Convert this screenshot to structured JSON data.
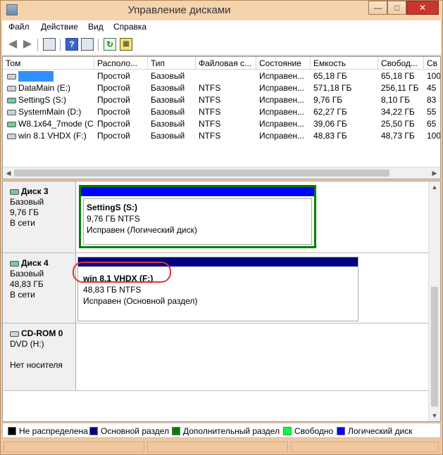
{
  "window": {
    "title": "Управление дисками"
  },
  "menu": [
    {
      "label": "Файл"
    },
    {
      "label": "Действие"
    },
    {
      "label": "Вид"
    },
    {
      "label": "Справка"
    }
  ],
  "toolbar": {
    "icons": [
      "back-icon",
      "forward-icon",
      "console-tree-icon",
      "help-icon",
      "show-action-pane-icon",
      "refresh-icon",
      "properties-icon"
    ]
  },
  "volumes": {
    "columns": [
      "Том",
      "Располо...",
      "Тип",
      "Файловая с...",
      "Состояние",
      "Емкость",
      "Свобод...",
      "Св"
    ],
    "rows": [
      {
        "name": "",
        "layout": "Простой",
        "type": "Базовый",
        "fs": "",
        "status": "Исправен...",
        "capacity": "65,18 ГБ",
        "free": "65,18 ГБ",
        "pct": "100"
      },
      {
        "name": "DataMain (E:)",
        "layout": "Простой",
        "type": "Базовый",
        "fs": "NTFS",
        "status": "Исправен...",
        "capacity": "571,18 ГБ",
        "free": "256,11 ГБ",
        "pct": "45"
      },
      {
        "name": "SettingS (S:)",
        "layout": "Простой",
        "type": "Базовый",
        "fs": "NTFS",
        "status": "Исправен...",
        "capacity": "9,76 ГБ",
        "free": "8,10 ГБ",
        "pct": "83"
      },
      {
        "name": "SystemMain (D:)",
        "layout": "Простой",
        "type": "Базовый",
        "fs": "NTFS",
        "status": "Исправен...",
        "capacity": "62,27 ГБ",
        "free": "34,22 ГБ",
        "pct": "55"
      },
      {
        "name": "W8.1x64_7mode (C:)",
        "layout": "Простой",
        "type": "Базовый",
        "fs": "NTFS",
        "status": "Исправен...",
        "capacity": "39,06 ГБ",
        "free": "25,50 ГБ",
        "pct": "65"
      },
      {
        "name": "win 8.1 VHDX (F:)",
        "layout": "Простой",
        "type": "Базовый",
        "fs": "NTFS",
        "status": "Исправен...",
        "capacity": "48,83 ГБ",
        "free": "48,73 ГБ",
        "pct": "100"
      }
    ]
  },
  "disks": [
    {
      "name": "Диск 3",
      "type": "Базовый",
      "size": "9,76 ГБ",
      "state": "В сети",
      "partition": {
        "name": "SettingS  (S:)",
        "size": "9,76 ГБ NTFS",
        "status": "Исправен (Логический диск)"
      }
    },
    {
      "name": "Диск 4",
      "type": "Базовый",
      "size": "48,83 ГБ",
      "state": "В сети",
      "partition": {
        "name": "win 8.1 VHDX  (F:)",
        "size": "48,83 ГБ NTFS",
        "status": "Исправен (Основной раздел)"
      }
    },
    {
      "name": "CD-ROM 0",
      "type": "DVD (H:)",
      "state": "Нет носителя"
    }
  ],
  "legend": [
    {
      "label": "Не распределена",
      "color": "#000000"
    },
    {
      "label": "Основной раздел",
      "color": "#000080"
    },
    {
      "label": "Дополнительный раздел",
      "color": "#007f00"
    },
    {
      "label": "Свободно",
      "color": "#00ff3c"
    },
    {
      "label": "Логический диск",
      "color": "#0000ff"
    }
  ],
  "colors": {
    "primary_bar": "#000080",
    "logical_bar": "#0000ff",
    "extended_border": "#007f00",
    "highlight": "#e03535"
  }
}
